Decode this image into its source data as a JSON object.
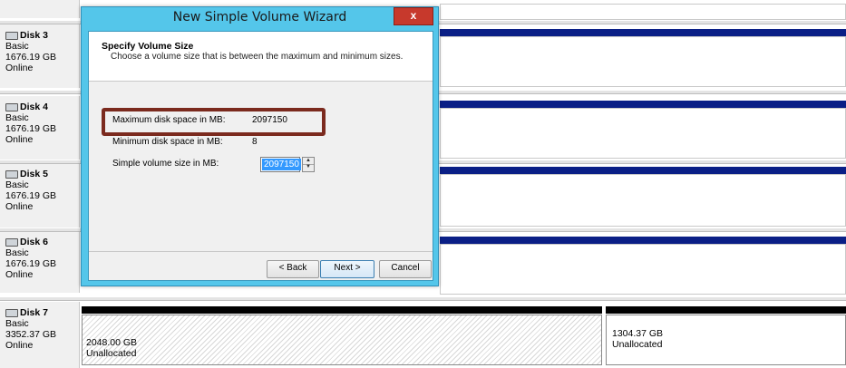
{
  "disks": [
    {
      "name": "Disk 3",
      "type": "Basic",
      "size": "1676.19 GB",
      "status": "Online"
    },
    {
      "name": "Disk 4",
      "type": "Basic",
      "size": "1676.19 GB",
      "status": "Online"
    },
    {
      "name": "Disk 5",
      "type": "Basic",
      "size": "1676.19 GB",
      "status": "Online"
    },
    {
      "name": "Disk 6",
      "type": "Basic",
      "size": "1676.19 GB",
      "status": "Online"
    },
    {
      "name": "Disk 7",
      "type": "Basic",
      "size": "3352.37 GB",
      "status": "Online"
    }
  ],
  "disk7_partitions": [
    {
      "size": "2048.00 GB",
      "label": "Unallocated"
    },
    {
      "size": "1304.37 GB",
      "label": "Unallocated"
    }
  ],
  "wizard": {
    "title": "New Simple Volume Wizard",
    "close_icon": "x-icon",
    "close_text": "x",
    "heading": "Specify Volume Size",
    "subheading": "Choose a volume size that is between the maximum and minimum sizes.",
    "max_label": "Maximum disk space in MB:",
    "max_value": "2097150",
    "min_label": "Minimum disk space in MB:",
    "min_value": "8",
    "size_label": "Simple volume size in MB:",
    "size_value": "2097150",
    "back_label": "< Back",
    "next_label": "Next >",
    "cancel_label": "Cancel"
  },
  "colors": {
    "dialog_frame": "#54c6ea",
    "volume_bar": "#0a1f86",
    "highlight_border": "#7b2a1e",
    "close_button": "#c7392c"
  }
}
